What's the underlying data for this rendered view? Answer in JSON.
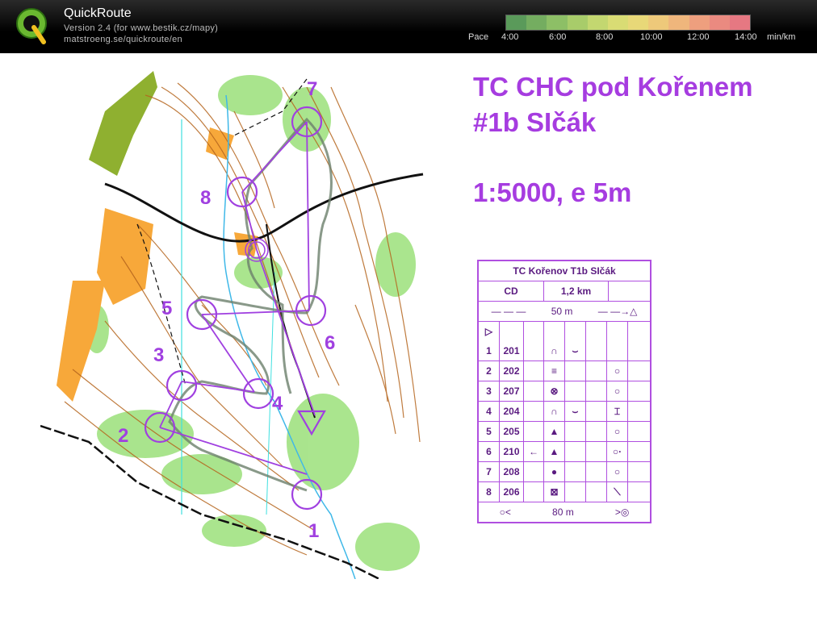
{
  "app": {
    "title": "QuickRoute",
    "version": "Version 2.4  (for www.bestik.cz/mapy)",
    "site": "matstroeng.se/quickroute/en"
  },
  "pace": {
    "label": "Pace",
    "ticks": [
      "4:00",
      "6:00",
      "8:00",
      "10:00",
      "12:00",
      "14:00"
    ],
    "unit": "min/km",
    "colors": [
      "#5a9a5a",
      "#74ad60",
      "#8dbf66",
      "#a8cc6a",
      "#c3d770",
      "#d9dc74",
      "#e8d878",
      "#eec97a",
      "#efb67c",
      "#ee9f7e",
      "#ea8a80",
      "#e67882"
    ]
  },
  "event": {
    "title_line1": "TC CHC pod Kořenem",
    "title_line2": "#1b SIčák",
    "scale": "1:5000, e 5m"
  },
  "description": {
    "header": "TC Kořenov T1b SIčák",
    "class": "CD",
    "length": "1,2 km",
    "start_note": "50 m",
    "finish_note": "80 m",
    "controls": [
      {
        "num": "1",
        "code": "201"
      },
      {
        "num": "2",
        "code": "202"
      },
      {
        "num": "3",
        "code": "207"
      },
      {
        "num": "4",
        "code": "204"
      },
      {
        "num": "5",
        "code": "205"
      },
      {
        "num": "6",
        "code": "210"
      },
      {
        "num": "7",
        "code": "208"
      },
      {
        "num": "8",
        "code": "206"
      }
    ]
  },
  "map": {
    "control_labels": [
      "1",
      "2",
      "3",
      "4",
      "5",
      "6",
      "7",
      "8"
    ],
    "course_color": "#a040e0"
  }
}
